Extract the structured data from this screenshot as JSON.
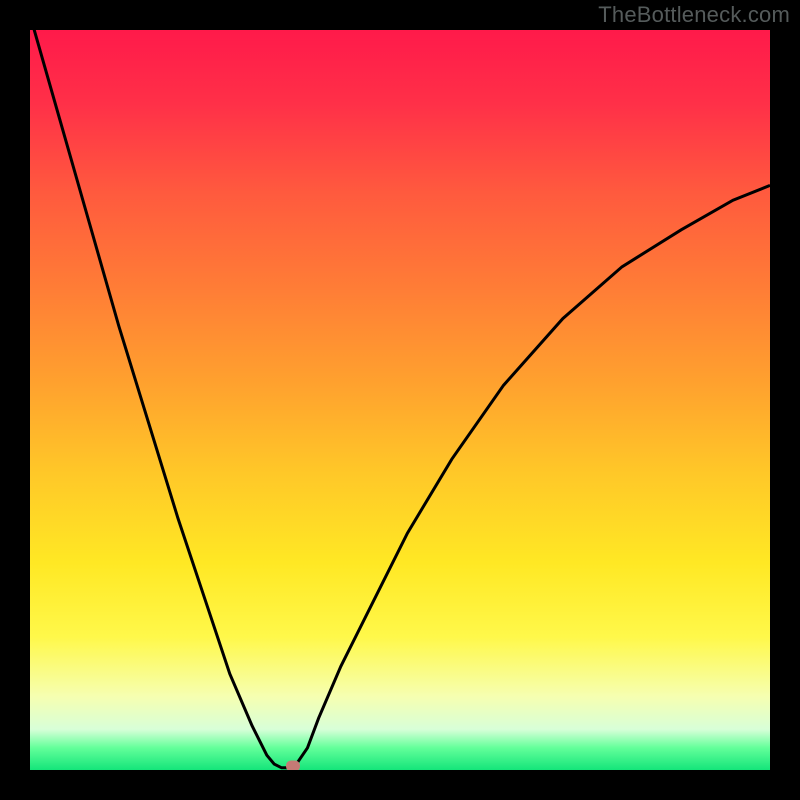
{
  "attribution": "TheBottleneck.com",
  "colors": {
    "frame": "#000000",
    "attribution_text": "#555b5b",
    "curve_stroke": "#000000",
    "marker_fill": "#c57a75",
    "gradient_stops": [
      {
        "offset": 0.0,
        "color": "#ff1a4a"
      },
      {
        "offset": 0.1,
        "color": "#ff3048"
      },
      {
        "offset": 0.22,
        "color": "#ff5a3e"
      },
      {
        "offset": 0.35,
        "color": "#ff7d36"
      },
      {
        "offset": 0.48,
        "color": "#ffa22e"
      },
      {
        "offset": 0.6,
        "color": "#ffc828"
      },
      {
        "offset": 0.72,
        "color": "#ffe824"
      },
      {
        "offset": 0.82,
        "color": "#fff84a"
      },
      {
        "offset": 0.9,
        "color": "#f6ffb0"
      },
      {
        "offset": 0.945,
        "color": "#d8ffd8"
      },
      {
        "offset": 0.97,
        "color": "#63ff9a"
      },
      {
        "offset": 1.0,
        "color": "#14e57a"
      }
    ]
  },
  "chart_data": {
    "type": "line",
    "title": "",
    "xlabel": "",
    "ylabel": "",
    "xlim": [
      0,
      100
    ],
    "ylim": [
      0,
      100
    ],
    "series": [
      {
        "name": "bottleneck-curve",
        "x": [
          0,
          4,
          8,
          12,
          16,
          20,
          24,
          27,
          30,
          32,
          33,
          34,
          35,
          36,
          37.5,
          39,
          42,
          46,
          51,
          57,
          64,
          72,
          80,
          88,
          95,
          100
        ],
        "y": [
          102,
          88,
          74,
          60,
          47,
          34,
          22,
          13,
          6,
          2,
          0.8,
          0.3,
          0.3,
          0.8,
          3,
          7,
          14,
          22,
          32,
          42,
          52,
          61,
          68,
          73,
          77,
          79
        ]
      }
    ],
    "marker": {
      "x": 35.5,
      "y": 0.5
    },
    "note": "Values are visual estimates in percent of plot width/height; y is distance from bottom (0 = bottom green edge, 100 = top red edge)."
  }
}
